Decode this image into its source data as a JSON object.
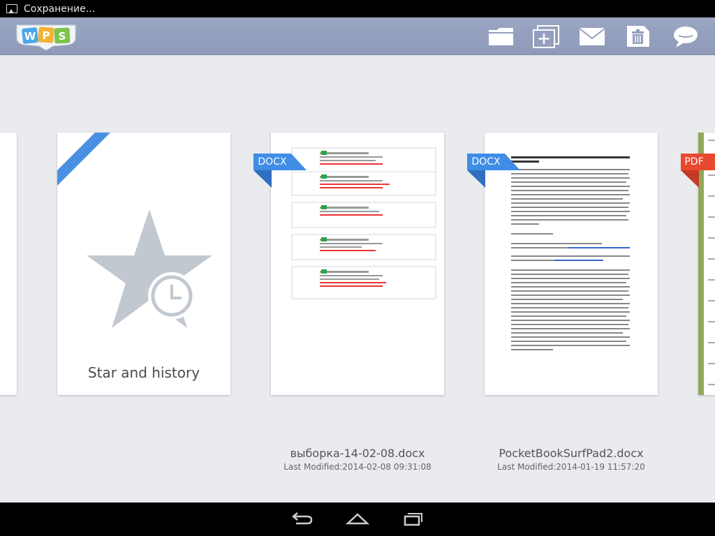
{
  "status": {
    "text": "Сохранение..."
  },
  "toolbar": {
    "logo_text": "WPS",
    "icons": [
      "open-folder-icon",
      "new-document-icon",
      "mail-icon",
      "delete-icon",
      "feedback-icon"
    ]
  },
  "cards": {
    "star": {
      "label": "Star and history"
    },
    "docs": [
      {
        "type": "DOCX",
        "name": "выборка-14-02-08.docx",
        "modified": "Last Modified:2014-02-08 09:31:08"
      },
      {
        "type": "DOCX",
        "name": "PocketBookSurfPad2.docx",
        "modified": "Last Modified:2014-01-19 11:57:20"
      },
      {
        "type": "PDF"
      }
    ]
  },
  "colors": {
    "docx_tag": "#3f8de6",
    "pdf_tag": "#e8492f",
    "ribbon": "#4a90e2",
    "toolbar": "#939fbd"
  },
  "nav": {
    "icons": [
      "back-icon",
      "home-icon",
      "recent-apps-icon"
    ]
  }
}
